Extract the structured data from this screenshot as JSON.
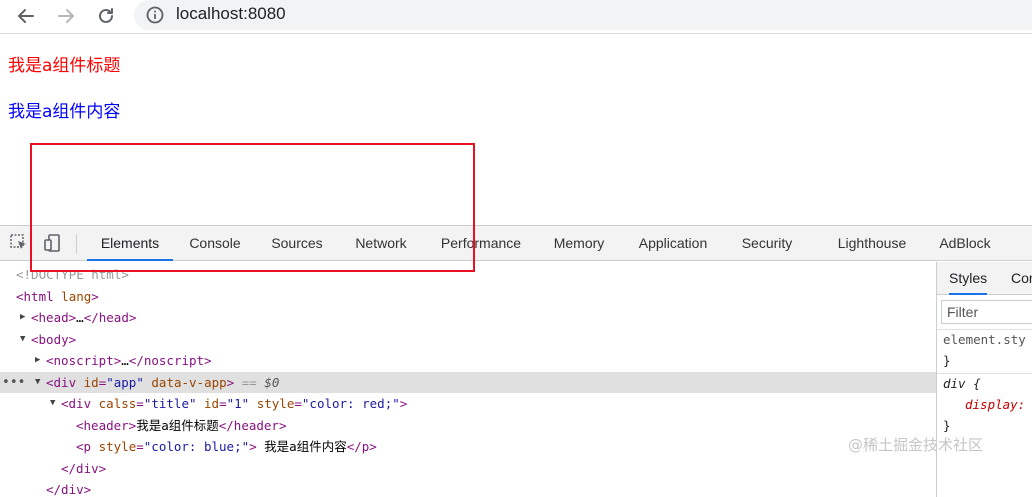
{
  "browser": {
    "url": "localhost:8080"
  },
  "page": {
    "title": "我是a组件标题",
    "content": "我是a组件内容"
  },
  "devtools": {
    "tabs": [
      "Elements",
      "Console",
      "Sources",
      "Network",
      "Performance",
      "Memory",
      "Application",
      "Security",
      "Lighthouse",
      "AdBlock"
    ],
    "active_tab": "Elements",
    "dom": {
      "doctype": "<!DOCTYPE html>",
      "html_open": "<html",
      "html_attr": "lang",
      "html_close": ">",
      "head_open": "<head>",
      "head_ellipsis": "…",
      "head_close": "</head>",
      "body": "<body>",
      "noscript_open": "<noscript>",
      "noscript_ellipsis": "…",
      "noscript_close": "</noscript>",
      "div_app_open": "<div",
      "div_app_id_attr": "id",
      "div_app_id_val": "\"app\"",
      "div_app_v_attr": "data-v-app",
      "div_app_close": ">",
      "div_app_eq": "==",
      "div_app_dollar": "$0",
      "div_title_open": "<div",
      "div_title_class_attr": "calss",
      "div_title_class_val": "\"title\"",
      "div_title_id_attr": "id",
      "div_title_id_val": "\"1\"",
      "div_title_style_attr": "style",
      "div_title_style_val": "\"color: red;\"",
      "div_title_close": ">",
      "header_open": "<header>",
      "header_text": "我是a组件标题",
      "header_close": "</header>",
      "p_open": "<p",
      "p_style_attr": "style",
      "p_style_val": "\"color: blue;\"",
      "p_gt": ">",
      "p_text": " 我是a组件内容",
      "p_close": "</p>",
      "div_end_inner": "</div>",
      "div_end_outer": "</div>"
    },
    "styles": {
      "tabs": [
        "Styles",
        "Con"
      ],
      "filter_placeholder": "Filter",
      "element_style": "element.sty",
      "close_brace": "}",
      "div_selector": "div {",
      "display_prop": "display:",
      "close_brace_2": "}"
    }
  },
  "watermark": "@稀土掘金技术社区"
}
